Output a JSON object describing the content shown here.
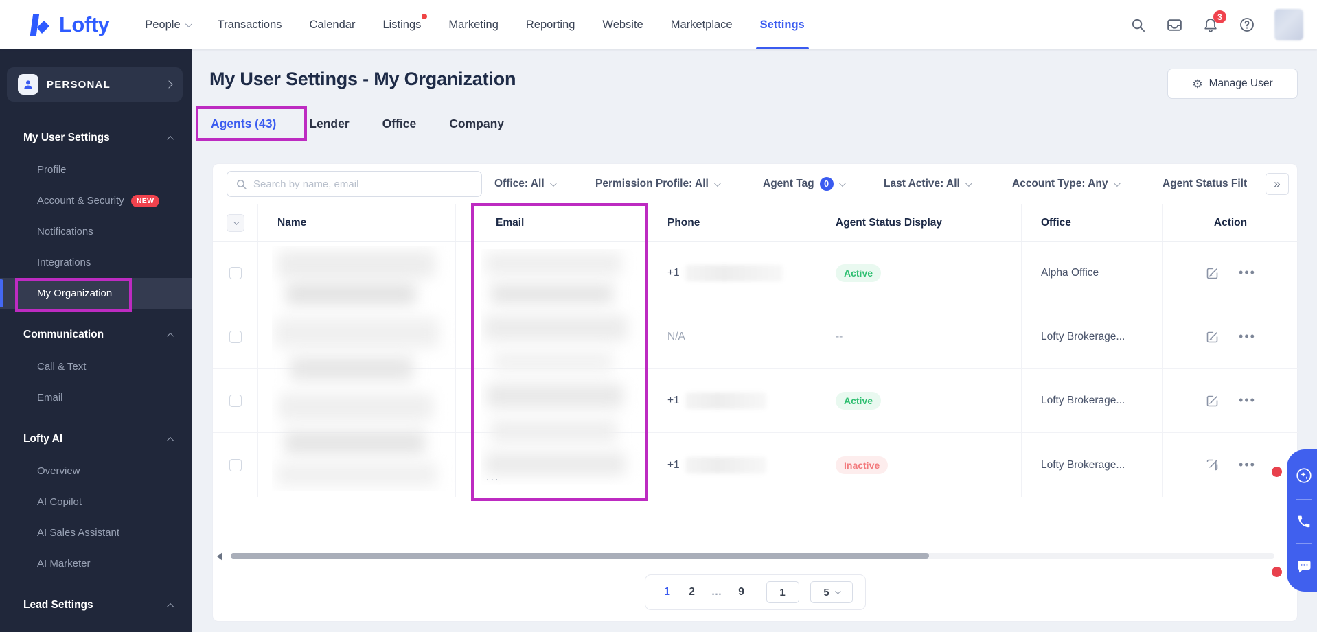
{
  "topnav": {
    "logo_text": "Lofty",
    "items": [
      {
        "label": "People"
      },
      {
        "label": "Transactions"
      },
      {
        "label": "Calendar"
      },
      {
        "label": "Listings"
      },
      {
        "label": "Marketing"
      },
      {
        "label": "Reporting"
      },
      {
        "label": "Website"
      },
      {
        "label": "Marketplace"
      },
      {
        "label": "Settings"
      }
    ],
    "notification_count": "3"
  },
  "sidebar": {
    "org_label": "PERSONAL",
    "sections": [
      {
        "title": "My User Settings",
        "items": [
          {
            "label": "Profile"
          },
          {
            "label": "Account & Security",
            "badge": "NEW"
          },
          {
            "label": "Notifications"
          },
          {
            "label": "Integrations"
          },
          {
            "label": "My Organization"
          }
        ]
      },
      {
        "title": "Communication",
        "items": [
          {
            "label": "Call & Text"
          },
          {
            "label": "Email"
          }
        ]
      },
      {
        "title": "Lofty AI",
        "items": [
          {
            "label": "Overview"
          },
          {
            "label": "AI Copilot"
          },
          {
            "label": "AI Sales Assistant"
          },
          {
            "label": "AI Marketer"
          }
        ]
      },
      {
        "title": "Lead Settings",
        "items": []
      }
    ]
  },
  "main": {
    "title": "My User Settings - My Organization",
    "manage_user_label": "Manage User",
    "tabs": [
      {
        "label": "Agents (43)"
      },
      {
        "label": "Lender"
      },
      {
        "label": "Office"
      },
      {
        "label": "Company"
      }
    ],
    "filters": {
      "search_placeholder": "Search by name, email",
      "dropdowns": [
        {
          "label": "Office: All"
        },
        {
          "label": "Permission Profile: All"
        },
        {
          "label": "Agent Tag",
          "badge": "0"
        },
        {
          "label": "Last Active: All"
        },
        {
          "label": "Account Type: Any"
        },
        {
          "label": "Agent Status Filt"
        }
      ],
      "expand_label": "»"
    },
    "table": {
      "columns": [
        "Name",
        "Email",
        "Phone",
        "Agent Status Display",
        "Office",
        "Action"
      ],
      "email_ellipsis": "...",
      "rows": [
        {
          "phone": "+1",
          "status": "Active",
          "office": "Alpha Office"
        },
        {
          "phone": "N/A",
          "status": "--",
          "office": "Lofty Brokerage..."
        },
        {
          "phone": "+1",
          "status": "Active",
          "office": "Lofty Brokerage..."
        },
        {
          "phone": "+1",
          "status": "Inactive",
          "office": "Lofty Brokerage..."
        }
      ]
    },
    "pagination": {
      "pages": [
        "1",
        "2",
        "…",
        "9"
      ],
      "jump_value": "1",
      "page_size": "5"
    }
  }
}
